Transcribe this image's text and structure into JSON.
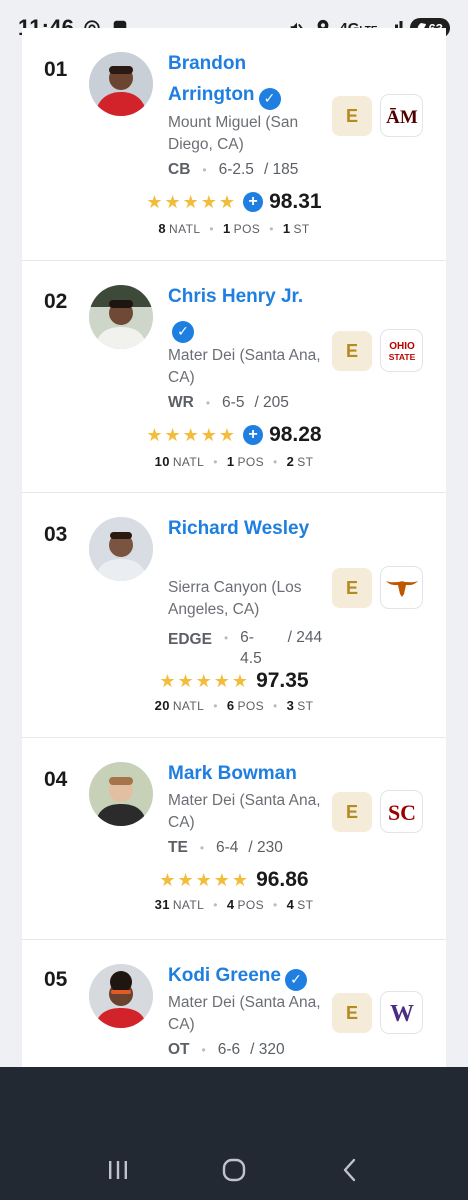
{
  "status_bar": {
    "time": "11:46",
    "network": "4G",
    "network_sub": "LTE",
    "battery": "63"
  },
  "players": [
    {
      "rank": "01",
      "name": "Brandon Arrington",
      "verified": true,
      "school": "Mount Miguel (San Diego, CA)",
      "position": "CB",
      "height": "6-2.5",
      "weight": "/ 185",
      "stars": 5,
      "plus": true,
      "rating": "98.31",
      "natl": "8",
      "pos_rank": "1",
      "st_rank": "1",
      "commit_badge": "E",
      "team": "Texas A&M",
      "team_color": "#500000"
    },
    {
      "rank": "02",
      "name": "Chris Henry Jr.",
      "verified": true,
      "school": "Mater Dei (Santa Ana, CA)",
      "position": "WR",
      "height": "6-5",
      "weight": "/ 205",
      "stars": 5,
      "plus": true,
      "rating": "98.28",
      "natl": "10",
      "pos_rank": "1",
      "st_rank": "2",
      "commit_badge": "E",
      "team": "Ohio State",
      "team_color": "#bb0000"
    },
    {
      "rank": "03",
      "name": "Richard Wesley",
      "verified": false,
      "school": "Sierra Canyon (Los Angeles, CA)",
      "position": "EDGE",
      "height": "6-4.5",
      "weight": "/ 244",
      "stars": 5,
      "plus": false,
      "rating": "97.35",
      "natl": "20",
      "pos_rank": "6",
      "st_rank": "3",
      "commit_badge": "E",
      "team": "Texas",
      "team_color": "#bf5700"
    },
    {
      "rank": "04",
      "name": "Mark Bowman",
      "verified": false,
      "school": "Mater Dei (Santa Ana, CA)",
      "position": "TE",
      "height": "6-4",
      "weight": "/ 230",
      "stars": 5,
      "plus": false,
      "rating": "96.86",
      "natl": "31",
      "pos_rank": "4",
      "st_rank": "4",
      "commit_badge": "E",
      "team": "USC",
      "team_color": "#990000"
    },
    {
      "rank": "05",
      "name": "Kodi Greene",
      "verified": true,
      "school": "Mater Dei (Santa Ana, CA)",
      "position": "OT",
      "height": "6-6",
      "weight": "/ 320",
      "commit_badge": "E",
      "team": "Washington",
      "team_color": "#4b2e83"
    }
  ],
  "labels": {
    "natl": "NATL",
    "pos": "POS",
    "st": "ST",
    "star_glyphs": "★★★★★",
    "plus_glyph": "+",
    "check_glyph": "✓"
  },
  "logos": {
    "tamu": "ĀM",
    "osu_top": "OHIO",
    "osu_bottom": "STATE",
    "usc": "SC",
    "uw": "W"
  }
}
